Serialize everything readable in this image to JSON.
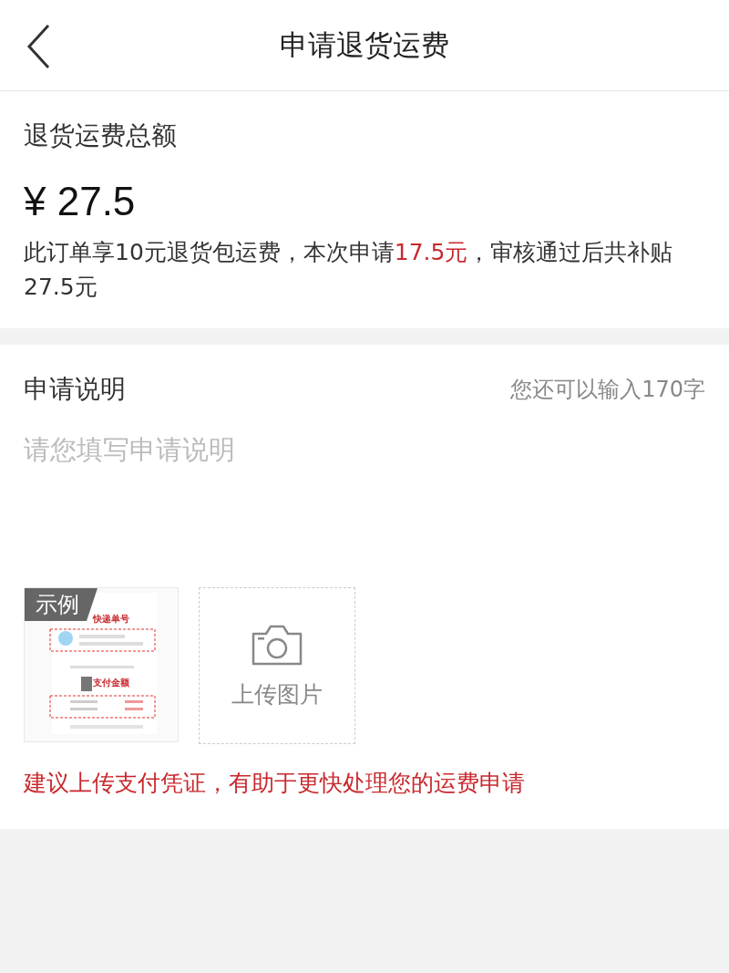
{
  "header": {
    "title": "申请退货运费"
  },
  "summary": {
    "label": "退货运费总额",
    "amount": "¥ 27.5",
    "note_parts": [
      "此订单享10元退货包运费，本次申请",
      "17.5元",
      "，审核通过后共补贴27.5元"
    ]
  },
  "application": {
    "label": "申请说明",
    "counter": "您还可以输入170字",
    "placeholder": "请您填写申请说明",
    "example": {
      "badge": "示例",
      "labels": [
        "快递单号",
        "支付金额"
      ]
    },
    "upload": {
      "label": "上传图片"
    },
    "hint": "建议上传支付凭证，有助于更快处理您的运费申请"
  }
}
